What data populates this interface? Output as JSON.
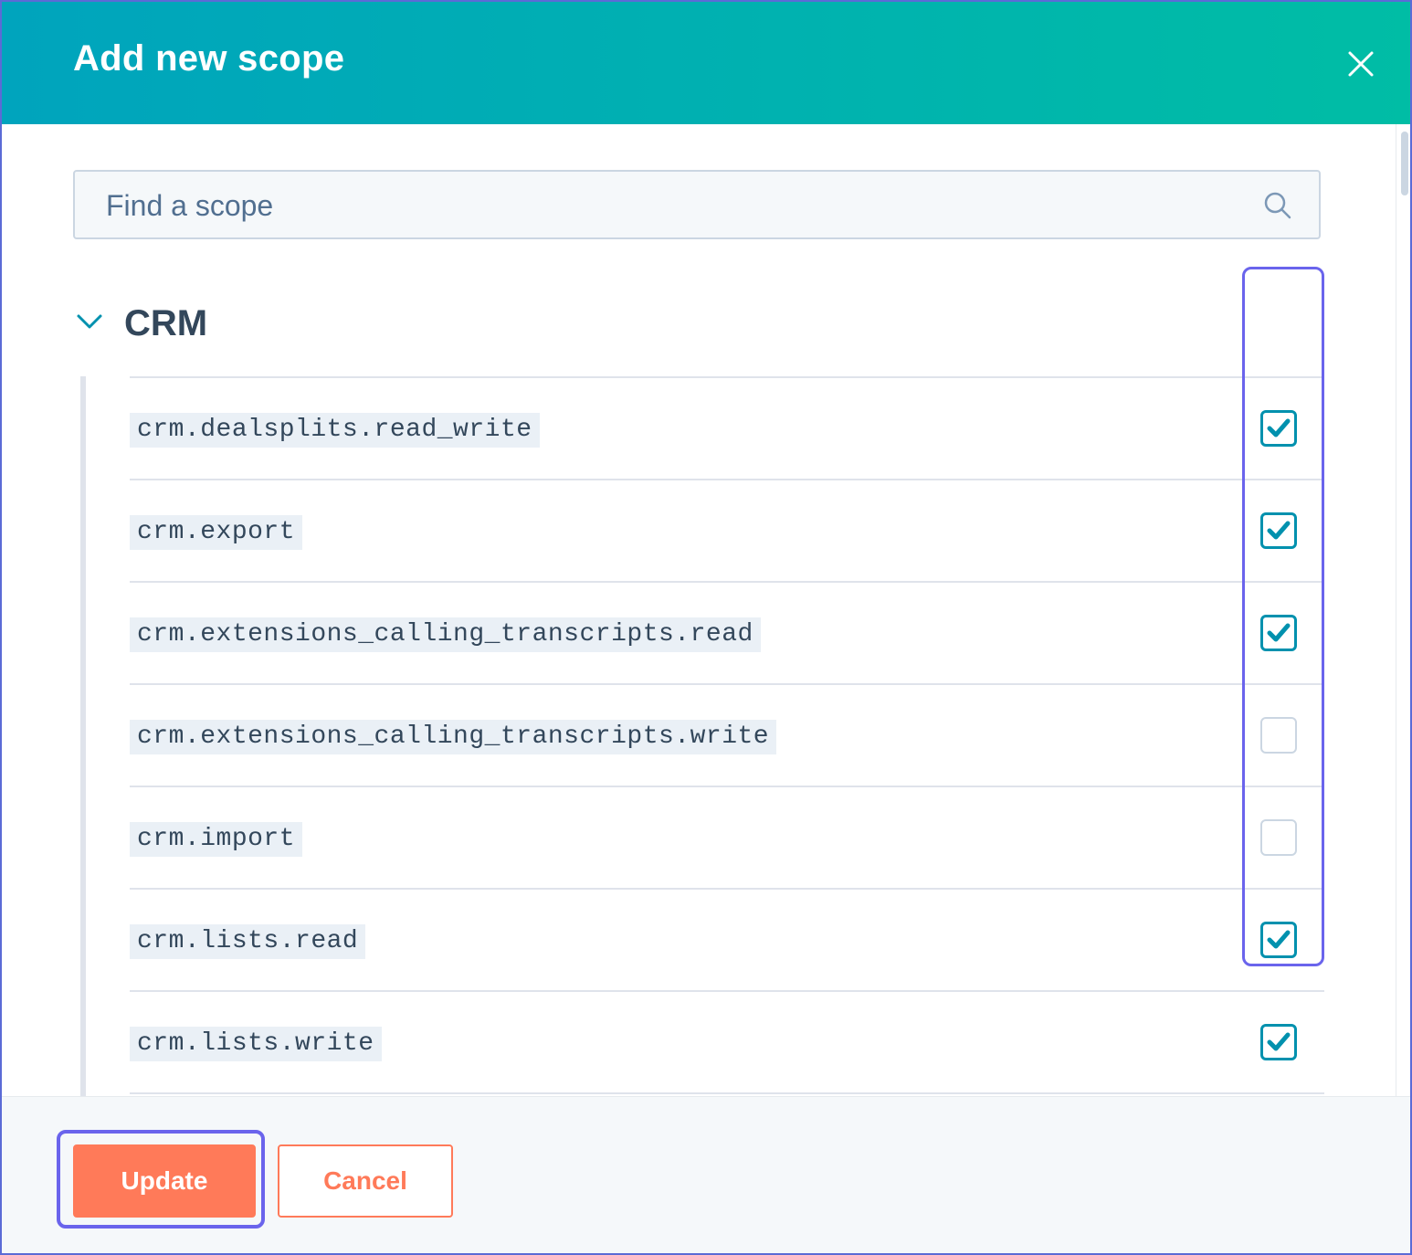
{
  "modal": {
    "title": "Add new scope"
  },
  "search": {
    "placeholder": "Find a scope"
  },
  "section": {
    "title": "CRM"
  },
  "scopes": [
    {
      "name": "crm.dealsplits.read_write",
      "checked": true
    },
    {
      "name": "crm.export",
      "checked": true
    },
    {
      "name": "crm.extensions_calling_transcripts.read",
      "checked": true
    },
    {
      "name": "crm.extensions_calling_transcripts.write",
      "checked": false
    },
    {
      "name": "crm.import",
      "checked": false
    },
    {
      "name": "crm.lists.read",
      "checked": true
    },
    {
      "name": "crm.lists.write",
      "checked": true
    }
  ],
  "footer": {
    "update_label": "Update",
    "cancel_label": "Cancel"
  },
  "colors": {
    "header_start": "#00a4bd",
    "header_end": "#00bda5",
    "primary_button": "#ff7a59",
    "checkbox_checked": "#0091ae",
    "highlight": "#6a64ec"
  },
  "icons": {
    "close": "close-icon",
    "search": "search-icon",
    "collapse": "chevron-down-icon",
    "check": "checkmark-icon"
  }
}
